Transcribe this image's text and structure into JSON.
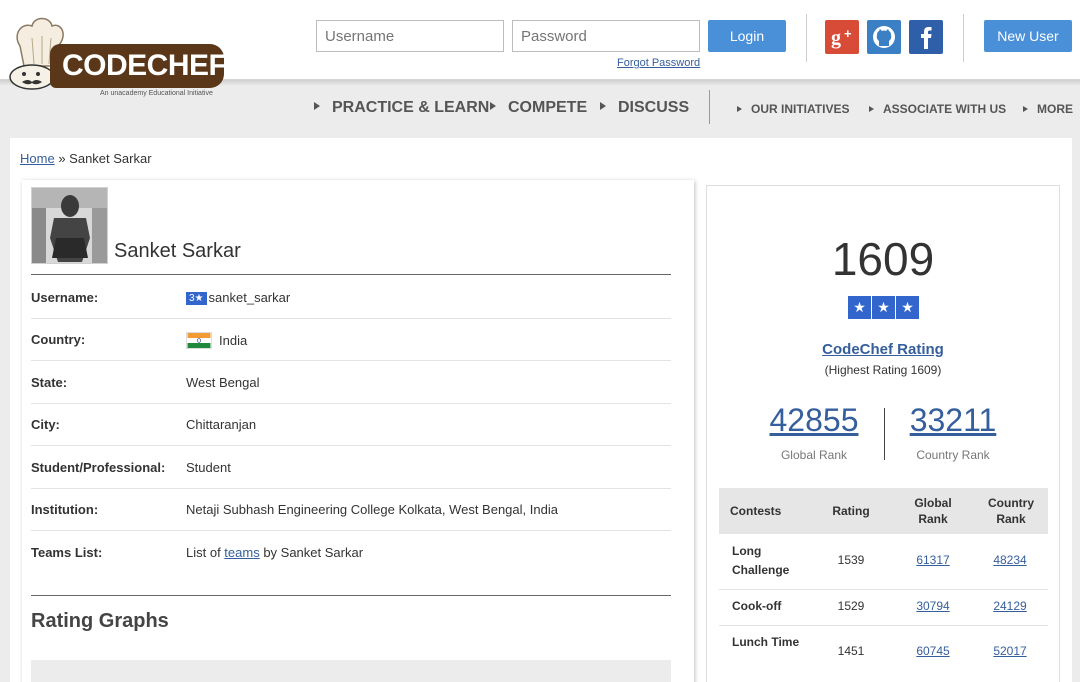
{
  "header": {
    "logo_text": "CODECHEF",
    "logo_tagline": "An unacademy Educational Initiative",
    "username_placeholder": "Username",
    "password_placeholder": "Password",
    "login_label": "Login",
    "forgot_password": "Forgot Password",
    "new_user_label": "New User",
    "social": [
      "google-plus-icon",
      "github-icon",
      "facebook-icon"
    ]
  },
  "nav": {
    "main": [
      "PRACTICE & LEARN",
      "COMPETE",
      "DISCUSS"
    ],
    "secondary": [
      "OUR INITIATIVES",
      "ASSOCIATE WITH US",
      "MORE"
    ]
  },
  "breadcrumb": {
    "home": "Home",
    "separator": "»",
    "current": "Sanket Sarkar"
  },
  "profile": {
    "name": "Sanket Sarkar",
    "fields": [
      {
        "label": "Username:",
        "badge": "3★",
        "value": "sanket_sarkar"
      },
      {
        "label": "Country:",
        "value": "India"
      },
      {
        "label": "State:",
        "value": "West Bengal"
      },
      {
        "label": "City:",
        "value": "Chittaranjan"
      },
      {
        "label": "Student/Professional:",
        "value": "Student"
      },
      {
        "label": "Institution:",
        "value": "Netaji Subhash Engineering College Kolkata, West Bengal, India"
      },
      {
        "label": "Teams List:",
        "prefix": "List of ",
        "link": "teams",
        "suffix": " by Sanket Sarkar"
      }
    ],
    "rating_graphs_title": "Rating Graphs"
  },
  "rating": {
    "value": "1609",
    "stars": 3,
    "title": "CodeChef Rating",
    "highest": "(Highest Rating 1609)",
    "global_rank": "42855",
    "global_rank_label": "Global Rank",
    "country_rank": "33211",
    "country_rank_label": "Country Rank"
  },
  "contests_table": {
    "headers": [
      "Contests",
      "Rating",
      "Global Rank",
      "Country Rank"
    ],
    "rows": [
      {
        "contest": "Long Challenge",
        "rating": "1539",
        "global": "61317",
        "country": "48234"
      },
      {
        "contest": "Cook-off",
        "rating": "1529",
        "global": "30794",
        "country": "24129"
      },
      {
        "contest": "Lunch Time",
        "rating": "1451",
        "global": "60745",
        "country": "52017"
      }
    ]
  },
  "colors": {
    "accent": "#4a90d9",
    "link": "#355e9c",
    "star_badge": "#3366cc",
    "brand_brown": "#5a3719"
  }
}
